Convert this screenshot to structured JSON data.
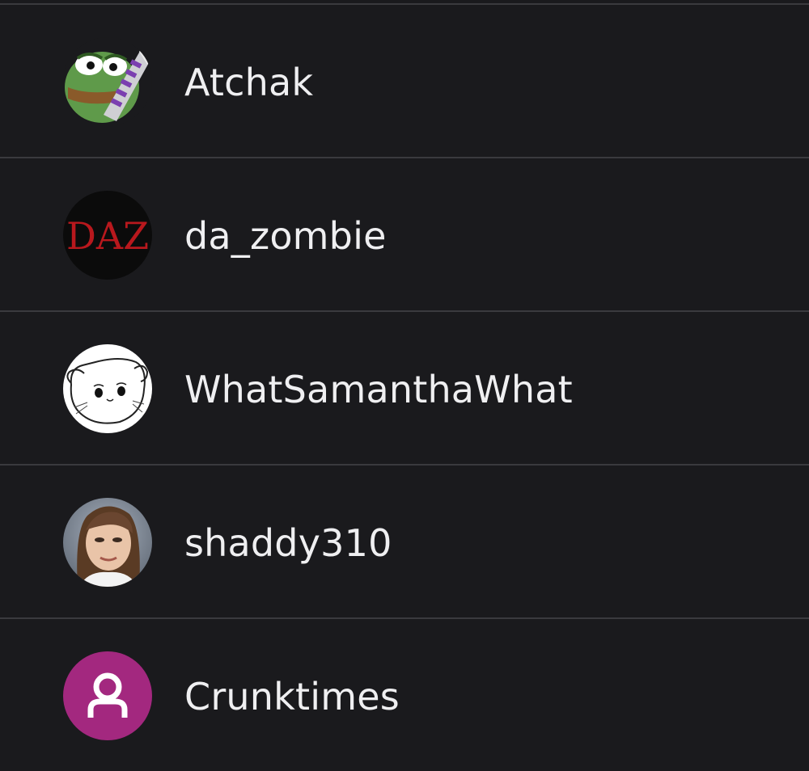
{
  "users": [
    {
      "name": "Atchak",
      "avatar_icon": "frog-with-knife-avatar"
    },
    {
      "name": "da_zombie",
      "avatar_icon": "daz-logo-avatar",
      "avatar_text": "DAZ"
    },
    {
      "name": "WhatSamanthaWhat",
      "avatar_icon": "sad-cat-sketch-avatar"
    },
    {
      "name": "shaddy310",
      "avatar_icon": "portrait-photo-avatar"
    },
    {
      "name": "Crunktimes",
      "avatar_icon": "default-user-avatar",
      "avatar_color": "#a3287f"
    }
  ]
}
